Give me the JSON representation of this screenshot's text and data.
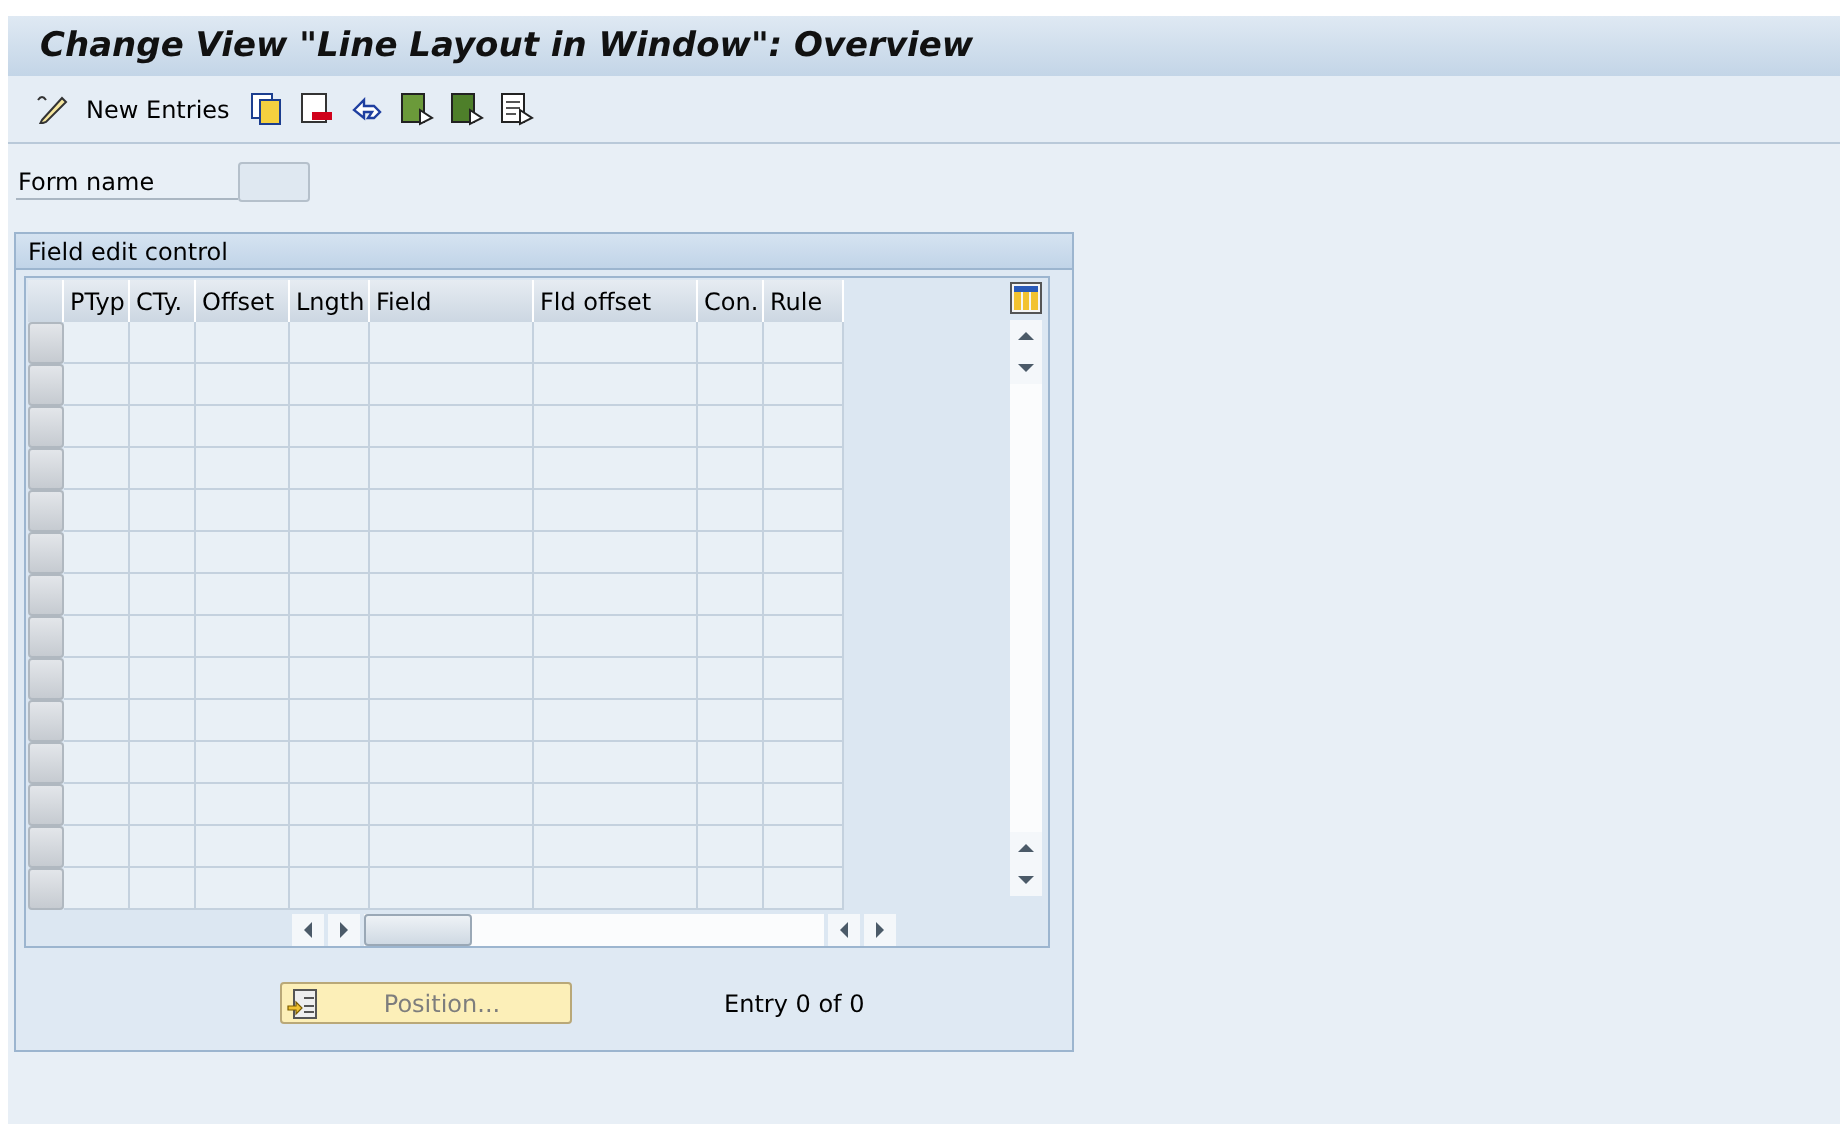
{
  "window": {
    "title": "Change View \"Line Layout in Window\": Overview"
  },
  "toolbar": {
    "new_entries": "New Entries",
    "icons": [
      {
        "kind": "copy"
      },
      {
        "kind": "delete"
      },
      {
        "kind": "undo"
      },
      {
        "kind": "select"
      },
      {
        "kind": "select-block"
      },
      {
        "kind": "deselect"
      }
    ]
  },
  "form": {
    "label": "Form name"
  },
  "group": {
    "title": "Field edit control",
    "table": {
      "columns": [
        "PTyp",
        "CTy.",
        "Offset",
        "Lngth",
        "Field",
        "Fld offset",
        "Con.",
        "Rule"
      ]
    },
    "position_button": {
      "label": "Position...",
      "disabled": true
    },
    "entry_info": "Entry 0 of 0"
  }
}
